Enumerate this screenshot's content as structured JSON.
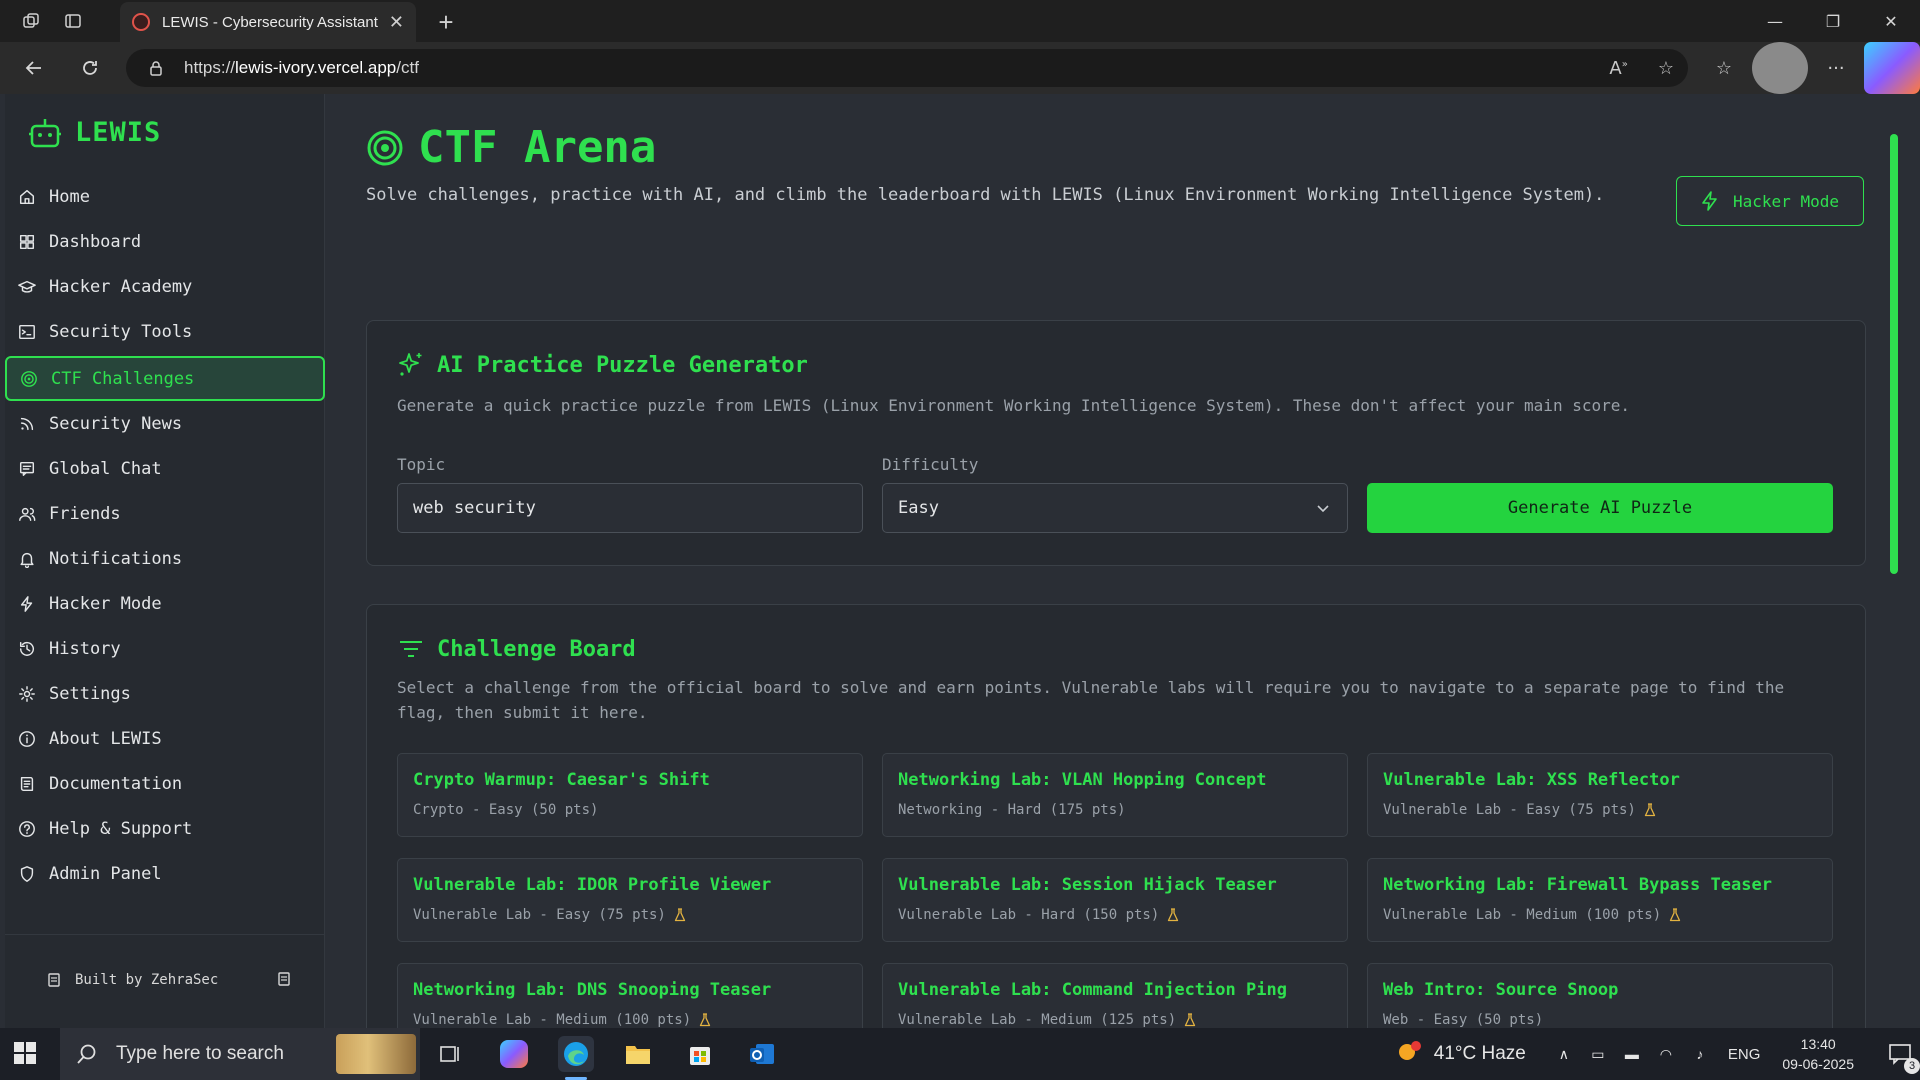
{
  "browser": {
    "tab_title": "LEWIS - Cybersecurity Assistant",
    "tab_close": "✕",
    "new_tab": "+",
    "url_prefix": "https://",
    "url_host": "lewis-ivory.vercel.app",
    "url_path": "/ctf",
    "window_controls": [
      "—",
      "❐",
      "✕"
    ]
  },
  "sidebar": {
    "brand": "LEWIS",
    "items": [
      {
        "label": "Home",
        "icon": "home-icon"
      },
      {
        "label": "Dashboard",
        "icon": "dashboard-icon"
      },
      {
        "label": "Hacker Academy",
        "icon": "graduation-cap-icon"
      },
      {
        "label": "Security Tools",
        "icon": "terminal-icon"
      },
      {
        "label": "CTF Challenges",
        "icon": "target-icon",
        "active": true
      },
      {
        "label": "Security News",
        "icon": "rss-icon"
      },
      {
        "label": "Global Chat",
        "icon": "message-icon"
      },
      {
        "label": "Friends",
        "icon": "users-icon"
      },
      {
        "label": "Notifications",
        "icon": "bell-icon"
      },
      {
        "label": "Hacker Mode",
        "icon": "zap-icon"
      },
      {
        "label": "History",
        "icon": "history-icon"
      },
      {
        "label": "Settings",
        "icon": "gear-icon"
      },
      {
        "label": "About LEWIS",
        "icon": "info-icon"
      },
      {
        "label": "Documentation",
        "icon": "book-icon"
      },
      {
        "label": "Help & Support",
        "icon": "help-icon"
      },
      {
        "label": "Admin Panel",
        "icon": "shield-icon"
      }
    ],
    "footer": "Built by ZehraSec"
  },
  "page": {
    "title": "CTF Arena",
    "subtitle": "Solve challenges, practice with AI, and climb the leaderboard with LEWIS (Linux Environment Working Intelligence System).",
    "hacker_mode_button": "Hacker Mode"
  },
  "generator": {
    "title": "AI Practice Puzzle Generator",
    "description": "Generate a quick practice puzzle from LEWIS (Linux Environment Working Intelligence System). These don't affect your main score.",
    "topic_label": "Topic",
    "topic_value": "web security",
    "difficulty_label": "Difficulty",
    "difficulty_value": "Easy",
    "generate_button": "Generate AI Puzzle"
  },
  "board": {
    "title": "Challenge Board",
    "description": "Select a challenge from the official board to solve and earn points. Vulnerable labs will require you to navigate to a separate page to find the flag, then submit it here.",
    "challenges": [
      {
        "title": "Crypto Warmup: Caesar's Shift",
        "meta": "Crypto - Easy (50 pts)",
        "lab": false
      },
      {
        "title": "Networking Lab: VLAN Hopping Concept",
        "meta": "Networking - Hard (175 pts)",
        "lab": false
      },
      {
        "title": "Vulnerable Lab: XSS Reflector",
        "meta": "Vulnerable Lab - Easy (75 pts)",
        "lab": true
      },
      {
        "title": "Vulnerable Lab: IDOR Profile Viewer",
        "meta": "Vulnerable Lab - Easy (75 pts)",
        "lab": true
      },
      {
        "title": "Vulnerable Lab: Session Hijack Teaser",
        "meta": "Vulnerable Lab - Hard (150 pts)",
        "lab": true
      },
      {
        "title": "Networking Lab: Firewall Bypass Teaser",
        "meta": "Vulnerable Lab - Medium (100 pts)",
        "lab": true
      },
      {
        "title": "Networking Lab: DNS Snooping Teaser",
        "meta": "Vulnerable Lab - Medium (100 pts)",
        "lab": true
      },
      {
        "title": "Vulnerable Lab: Command Injection Ping",
        "meta": "Vulnerable Lab - Medium (125 pts)",
        "lab": true
      },
      {
        "title": "Web Intro: Source Snoop",
        "meta": "Web - Easy (50 pts)",
        "lab": false
      }
    ]
  },
  "taskbar": {
    "search_placeholder": "Type here to search",
    "weather": "41°C  Haze",
    "language": "ENG",
    "time": "13:40",
    "date": "09-06-2025",
    "notification_count": "3"
  },
  "colors": {
    "accent": "#2fe04f",
    "background": "#2a2e35",
    "sidebar": "#262a30"
  }
}
